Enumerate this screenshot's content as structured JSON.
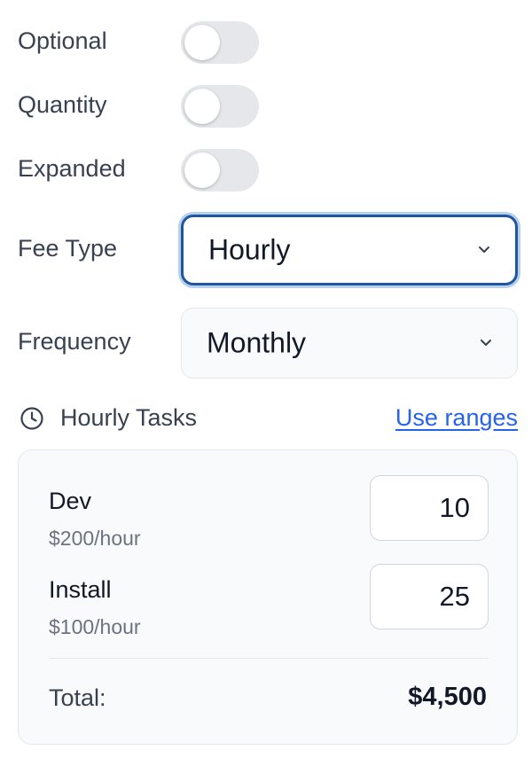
{
  "options": [
    {
      "label": "Optional",
      "on": false
    },
    {
      "label": "Quantity",
      "on": false
    },
    {
      "label": "Expanded",
      "on": false
    }
  ],
  "fee_type": {
    "label": "Fee Type",
    "value": "Hourly"
  },
  "frequency": {
    "label": "Frequency",
    "value": "Monthly"
  },
  "hourly_tasks": {
    "title": "Hourly Tasks",
    "icon": "clock-icon",
    "link": "Use ranges",
    "tasks": [
      {
        "name": "Dev",
        "rate": "$200/hour",
        "quantity": "10"
      },
      {
        "name": "Install",
        "rate": "$100/hour",
        "quantity": "25"
      }
    ],
    "total_label": "Total:",
    "total_value": "$4,500"
  },
  "colors": {
    "focus_border": "#1e56a0",
    "link": "#2563eb",
    "toggle_off": "#e5e7eb"
  }
}
